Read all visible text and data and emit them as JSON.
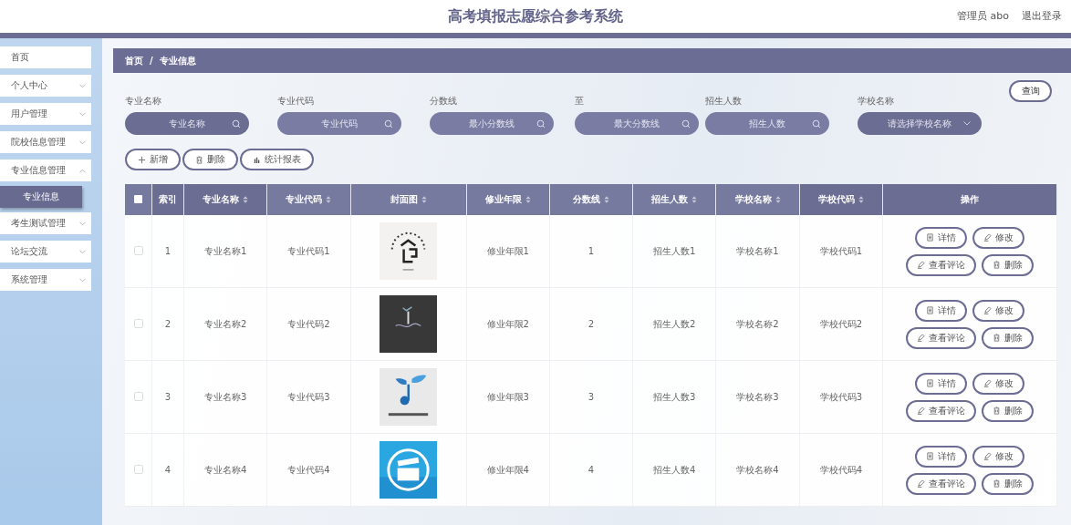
{
  "header": {
    "title": "高考填报志愿综合参考系统",
    "user": "管理员 abo",
    "logout": "退出登录"
  },
  "sidebar": {
    "items": [
      {
        "label": "首页",
        "kind": "link"
      },
      {
        "label": "个人中心",
        "kind": "menu"
      },
      {
        "label": "用户管理",
        "kind": "menu"
      },
      {
        "label": "院校信息管理",
        "kind": "menu"
      },
      {
        "label": "专业信息管理",
        "kind": "menu",
        "expanded": true,
        "children": [
          {
            "label": "专业信息",
            "selected": true
          }
        ]
      },
      {
        "label": "考生测试管理",
        "kind": "menu"
      },
      {
        "label": "论坛交流",
        "kind": "menu"
      },
      {
        "label": "系统管理",
        "kind": "menu"
      }
    ]
  },
  "breadcrumb": [
    "首页",
    "专业信息"
  ],
  "breadcrumb_separator": "/",
  "filters": [
    {
      "label": "专业名称",
      "placeholder": "专业名称",
      "kind": "search"
    },
    {
      "label": "专业代码",
      "placeholder": "专业代码",
      "kind": "search"
    },
    {
      "label": "分数线",
      "placeholder": "最小分数线",
      "kind": "search"
    },
    {
      "label": "至",
      "placeholder": "最大分数线",
      "kind": "search"
    },
    {
      "label": "招生人数",
      "placeholder": "招生人数",
      "kind": "search"
    },
    {
      "label": "学校名称",
      "placeholder": "请选择学校名称",
      "kind": "select"
    }
  ],
  "query_button": "查询",
  "toolbar": [
    {
      "label": "新增",
      "kind": "add"
    },
    {
      "label": "删除",
      "kind": "delete"
    },
    {
      "label": "统计报表",
      "kind": "chart"
    }
  ],
  "table": {
    "all_checked": false,
    "columns": [
      {
        "label": "索引",
        "sortable": false
      },
      {
        "label": "专业名称",
        "sortable": true
      },
      {
        "label": "专业代码",
        "sortable": true
      },
      {
        "label": "封面图",
        "sortable": true
      },
      {
        "label": "修业年限",
        "sortable": true
      },
      {
        "label": "分数线",
        "sortable": true
      },
      {
        "label": "招生人数",
        "sortable": true
      },
      {
        "label": "学校名称",
        "sortable": true
      },
      {
        "label": "学校代码",
        "sortable": true
      },
      {
        "label": "操作",
        "sortable": false
      }
    ],
    "rows": [
      {
        "checked": false,
        "index": "1",
        "name": "专业名称1",
        "code": "专业代码1",
        "years": "修业年限1",
        "score": "1",
        "enroll": "招生人数1",
        "school": "学校名称1",
        "school_code": "学校代码1",
        "actions": [
          {
            "label": "详情",
            "kind": "detail"
          },
          {
            "label": "修改",
            "kind": "edit"
          },
          {
            "label": "查看评论",
            "kind": "edit"
          },
          {
            "label": "删除",
            "kind": "delete"
          }
        ]
      },
      {
        "checked": false,
        "index": "2",
        "name": "专业名称2",
        "code": "专业代码2",
        "years": "修业年限2",
        "score": "2",
        "enroll": "招生人数2",
        "school": "学校名称2",
        "school_code": "学校代码2",
        "actions": [
          {
            "label": "详情",
            "kind": "detail"
          },
          {
            "label": "修改",
            "kind": "edit"
          },
          {
            "label": "查看评论",
            "kind": "edit"
          },
          {
            "label": "删除",
            "kind": "delete"
          }
        ]
      },
      {
        "checked": false,
        "index": "3",
        "name": "专业名称3",
        "code": "专业代码3",
        "years": "修业年限3",
        "score": "3",
        "enroll": "招生人数3",
        "school": "学校名称3",
        "school_code": "学校代码3",
        "actions": [
          {
            "label": "详情",
            "kind": "detail"
          },
          {
            "label": "修改",
            "kind": "edit"
          },
          {
            "label": "查看评论",
            "kind": "edit"
          },
          {
            "label": "删除",
            "kind": "delete"
          }
        ]
      },
      {
        "checked": false,
        "index": "4",
        "name": "专业名称4",
        "code": "专业代码4",
        "years": "修业年限4",
        "score": "4",
        "enroll": "招生人数4",
        "school": "学校名称4",
        "school_code": "学校代码4",
        "actions": [
          {
            "label": "详情",
            "kind": "detail"
          },
          {
            "label": "修改",
            "kind": "edit"
          },
          {
            "label": "查看评论",
            "kind": "edit"
          },
          {
            "label": "删除",
            "kind": "delete"
          }
        ]
      }
    ]
  }
}
